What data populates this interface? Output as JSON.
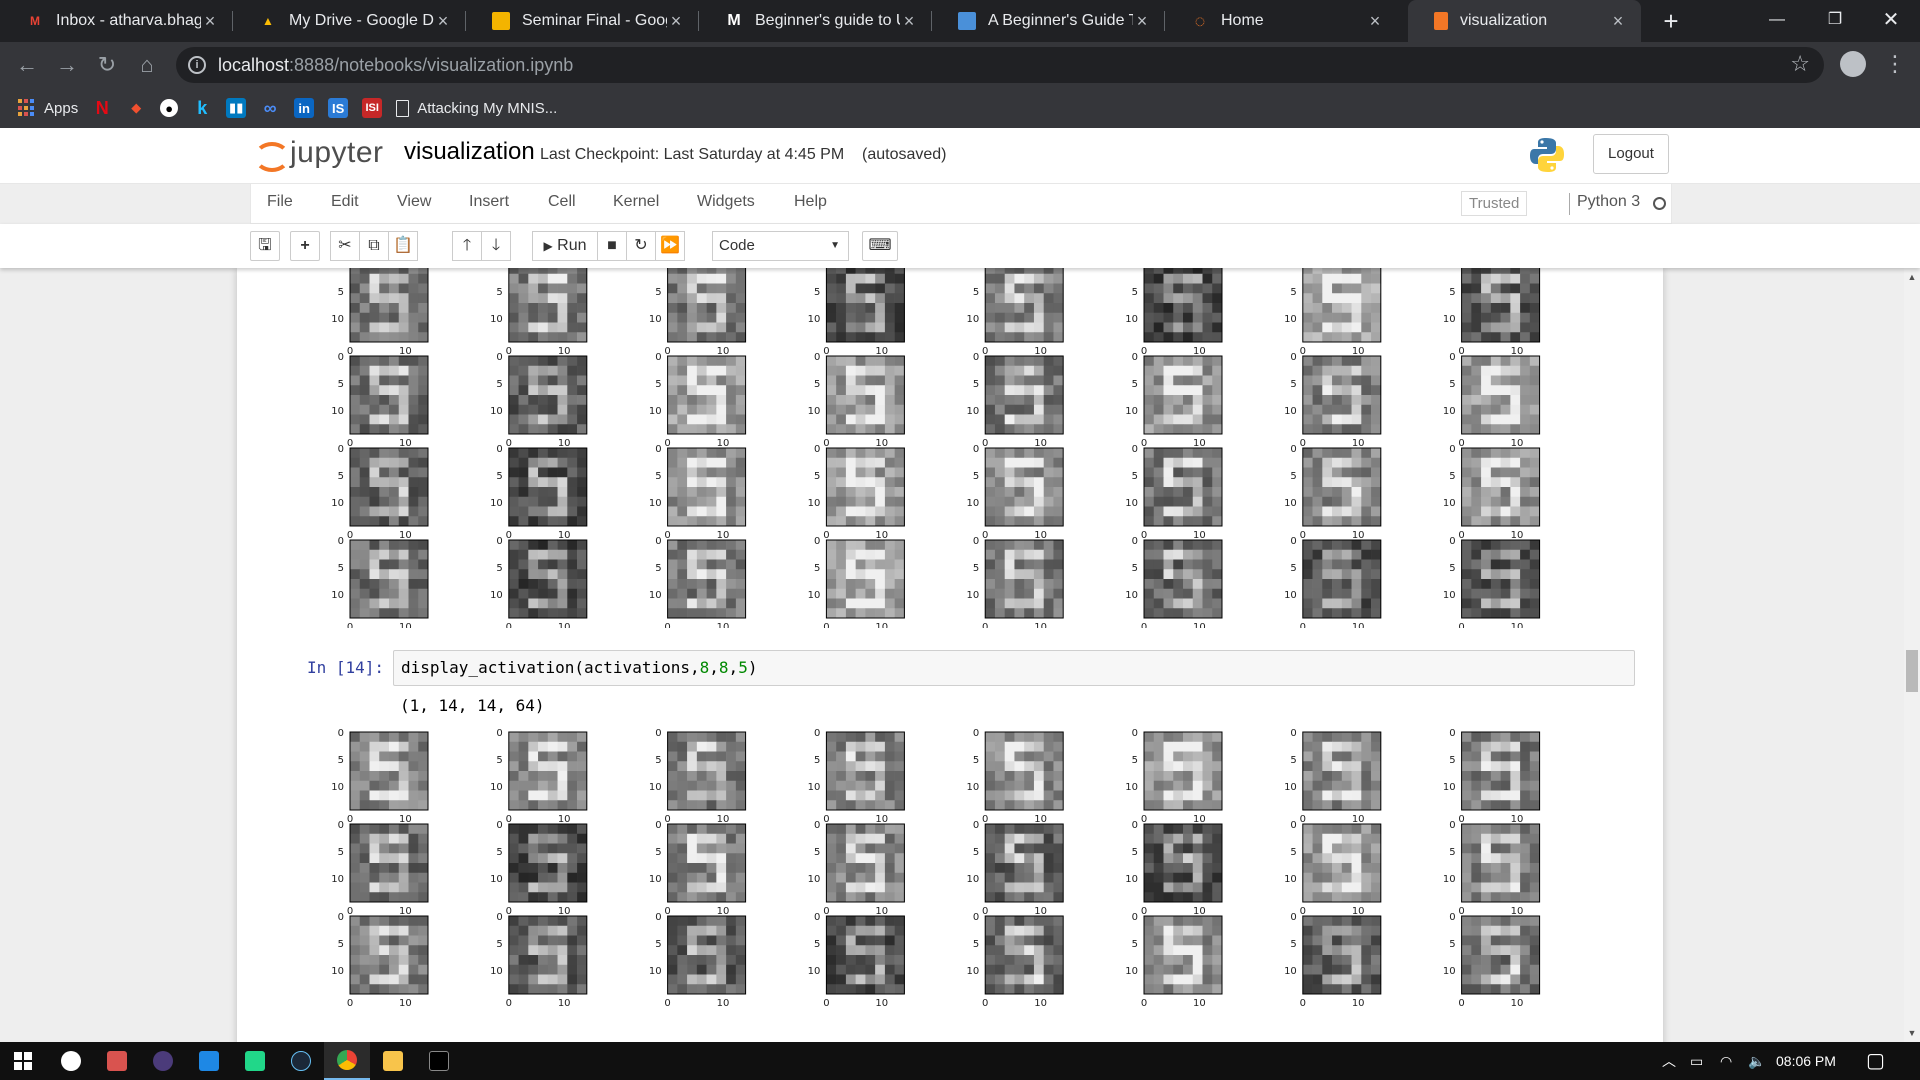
{
  "browser": {
    "tabs": [
      {
        "title": "Inbox - atharva.bhagwat",
        "icon": "gmail-icon",
        "icon_color": "#ea4335",
        "active": false
      },
      {
        "title": "My Drive - Google Drive",
        "icon": "drive-icon",
        "icon_color": "#fbbc04",
        "active": false
      },
      {
        "title": "Seminar Final - Google Slides",
        "icon": "slides-icon",
        "icon_color": "#f4b400",
        "active": false
      },
      {
        "title": "Beginner's guide to Un",
        "icon": "medium-icon",
        "icon_color": "#ffffff",
        "active": false
      },
      {
        "title": "A Beginner's Guide To",
        "icon": "page-icon",
        "icon_color": "#4a90d9",
        "active": false
      },
      {
        "title": "Home",
        "icon": "jupyter-icon",
        "icon_color": "#f37726",
        "active": false
      },
      {
        "title": "visualization",
        "icon": "notebook-icon",
        "icon_color": "#f37726",
        "active": true
      }
    ],
    "new_tab_label": "+",
    "url_host": "localhost",
    "url_rest": ":8888/notebooks/visualization.ipynb",
    "bookmarks": [
      {
        "label": "Apps",
        "icon": "apps-icon"
      },
      {
        "label": "",
        "icon": "netflix-icon"
      },
      {
        "label": "",
        "icon": "git-icon"
      },
      {
        "label": "",
        "icon": "github-icon"
      },
      {
        "label": "",
        "icon": "kaggle-icon"
      },
      {
        "label": "",
        "icon": "trello-icon"
      },
      {
        "label": "",
        "icon": "infinity-icon"
      },
      {
        "label": "",
        "icon": "linkedin-icon"
      },
      {
        "label": "",
        "icon": "is-icon"
      },
      {
        "label": "",
        "icon": "isi-icon"
      },
      {
        "label": "Attacking My MNIS...",
        "icon": "page-icon"
      }
    ]
  },
  "jupyter": {
    "logo_text": "jupyter",
    "notebook_name": "visualization",
    "checkpoint": "Last Checkpoint: Last Saturday at 4:45 PM",
    "autosave": "(autosaved)",
    "logout_label": "Logout",
    "menus": [
      "File",
      "Edit",
      "View",
      "Insert",
      "Cell",
      "Kernel",
      "Widgets",
      "Help"
    ],
    "trusted_label": "Trusted",
    "kernel_name": "Python 3",
    "run_label": "Run",
    "cell_type": "Code"
  },
  "notebook": {
    "cell_prompt": "In [14]:",
    "code_prefix": "display_activation(activations,",
    "code_args": [
      "8",
      "8",
      "5"
    ],
    "code_suffix": ")",
    "stdout": "(1, 14, 14, 64)",
    "y_ticks": [
      "0",
      "5",
      "10"
    ],
    "x_ticks": [
      "0",
      "10"
    ]
  },
  "taskbar": {
    "clock": "08:06 PM"
  }
}
